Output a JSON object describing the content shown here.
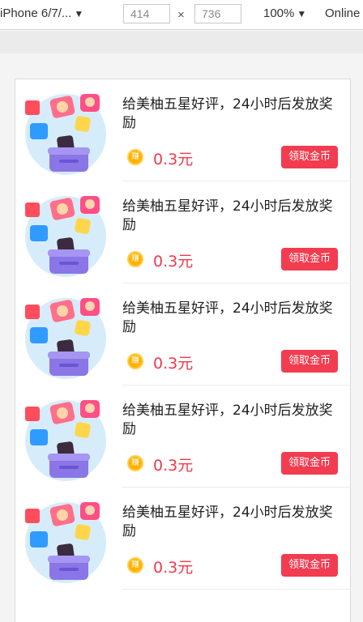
{
  "devtools": {
    "device": "iPhone 6/7/...",
    "caret": "▼",
    "width": "414",
    "times": "×",
    "height": "736",
    "zoom": "100%",
    "zoom_caret": "▼",
    "network": "Online"
  },
  "tasks": [
    {
      "title": "给美柚五星好评，24小时后发放奖励",
      "coin_label": "赚",
      "reward": "0.3元",
      "button": "领取金币"
    },
    {
      "title": "给美柚五星好评，24小时后发放奖励",
      "coin_label": "赚",
      "reward": "0.3元",
      "button": "领取金币"
    },
    {
      "title": "给美柚五星好评，24小时后发放奖励",
      "coin_label": "赚",
      "reward": "0.3元",
      "button": "领取金币"
    },
    {
      "title": "给美柚五星好评，24小时后发放奖励",
      "coin_label": "赚",
      "reward": "0.3元",
      "button": "领取金币"
    },
    {
      "title": "给美柚五星好评，24小时后发放奖励",
      "coin_label": "赚",
      "reward": "0.3元",
      "button": "领取金币"
    }
  ],
  "colors": {
    "accent_red": "#f23c50",
    "price_red": "#f0394d",
    "coin_gold": "#ffb100",
    "bag_purple": "#8a76e6"
  },
  "icons": [
    "app-bag-illustration",
    "coin-icon"
  ]
}
